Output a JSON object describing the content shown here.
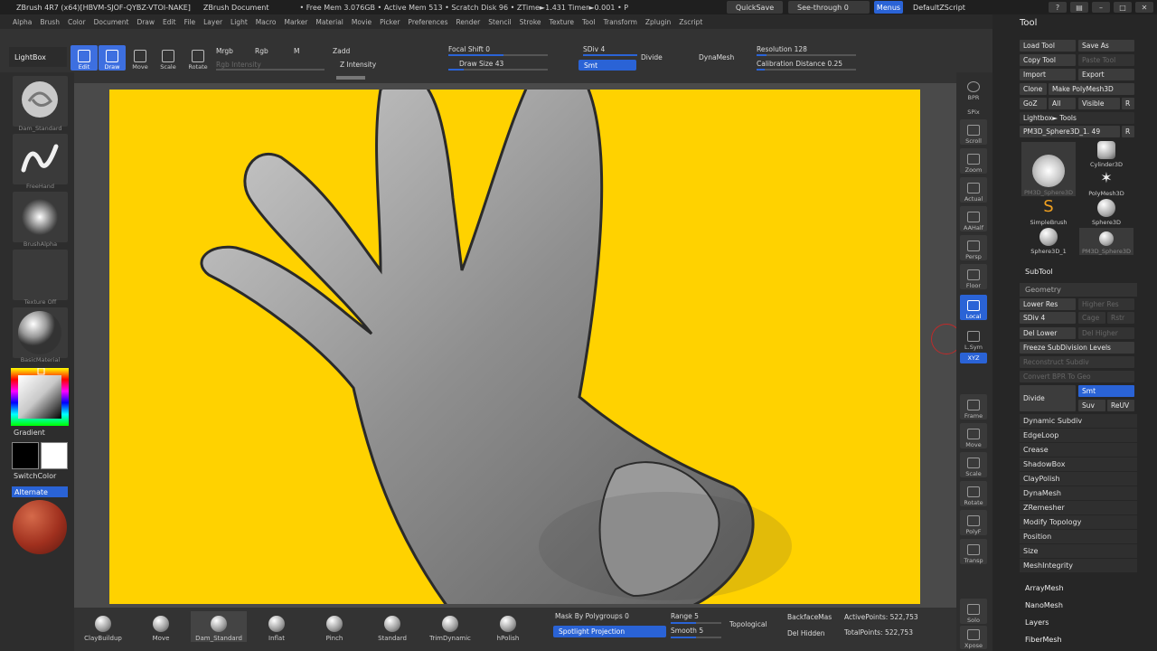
{
  "titlebar": {
    "app": "ZBrush 4R7 (x64)[HBVM-SJOF-QYBZ-VTOI-NAKE]",
    "document": "ZBrush Document",
    "stats": "• Free Mem 3.076GB • Active Mem 513 • Scratch Disk 96 • ZTime►1.431 Timer►0.001 • P",
    "quicksave": "QuickSave",
    "seethrough": "See-through  0",
    "menus": "Menus",
    "script": "DefaultZScript"
  },
  "menubar": [
    "Alpha",
    "Brush",
    "Color",
    "Document",
    "Draw",
    "Edit",
    "File",
    "Layer",
    "Light",
    "Macro",
    "Marker",
    "Material",
    "Movie",
    "Picker",
    "Preferences",
    "Render",
    "Stencil",
    "Stroke",
    "Texture",
    "Tool",
    "Transform",
    "Zplugin",
    "Zscript"
  ],
  "topshelf": {
    "lightbox": "LightBox",
    "edit": "Edit",
    "draw": "Draw",
    "move": "Move",
    "scale": "Scale",
    "rotate": "Rotate",
    "mrgb": "Mrgb",
    "rgb": "Rgb",
    "m": "M",
    "zadd": "Zadd",
    "rgb_intensity": "Rgb Intensity",
    "z_intensity": "Z Intensity",
    "focal_shift": "Focal Shift 0",
    "draw_size": "Draw Size 43",
    "sdiv": "SDiv 4",
    "smt": "Smt",
    "divide": "Divide",
    "dynamesh": "DynaMesh",
    "resolution": "Resolution 128",
    "calibration": "Calibration Distance 0.25"
  },
  "leftpanel": {
    "brush": "Dam_Standard",
    "stroke": "FreeHand",
    "alpha": "BrushAlpha",
    "texture": "Texture Off",
    "material": "BasicMaterial",
    "gradient": "Gradient",
    "switchcolor": "SwitchColor",
    "alternate": "Alternate"
  },
  "rightstrip": [
    "BPR",
    "SPix",
    "Scroll",
    "Zoom",
    "Actual",
    "AAHalf",
    "Persp",
    "Floor",
    "Local",
    "L.Sym",
    "XYZ",
    "Frame",
    "Move",
    "Scale",
    "Rotate",
    "PolyF",
    "Transp",
    "Solo",
    "Xpose"
  ],
  "bottomshelf": {
    "brushes": [
      "ClayBuildup",
      "Move",
      "Dam_Standard",
      "Inflat",
      "Pinch",
      "Standard",
      "TrimDynamic",
      "hPolish"
    ],
    "mask_by_polygroups": "Mask By Polygroups 0",
    "spotlight_projection": "Spotlight Projection",
    "range": "Range 5",
    "smooth": "Smooth 5",
    "topological": "Topological",
    "backfacemask": "BackfaceMas",
    "del_hidden": "Del Hidden",
    "active_points": "ActivePoints: 522,753",
    "total_points": "TotalPoints: 522,753"
  },
  "toolpanel": {
    "title": "Tool",
    "load_tool": "Load Tool",
    "save_as": "Save As",
    "copy_tool": "Copy Tool",
    "paste_tool": "Paste Tool",
    "import": "Import",
    "export": "Export",
    "clone": "Clone",
    "make_polymesh": "Make PolyMesh3D",
    "goz": "GoZ",
    "all": "All",
    "visible": "Visible",
    "r": "R",
    "lightbox_tools": "Lightbox► Tools",
    "current_tool": "PM3D_Sphere3D_1. 49",
    "tools": [
      "PM3D_Sphere3D",
      "Cylinder3D",
      "PolyMesh3D",
      "SimpleBrush",
      "Sphere3D",
      "Sphere3D_1",
      "PM3D_Sphere3D"
    ],
    "subtool": "SubTool",
    "geometry": "Geometry",
    "lower_res": "Lower Res",
    "higher_res": "Higher Res",
    "sdiv": "SDiv 4",
    "cage": "Cage",
    "rstr": "Rstr",
    "del_lower": "Del Lower",
    "del_higher": "Del Higher",
    "freeze": "Freeze SubDivision Levels",
    "reconstruct": "Reconstruct Subdiv",
    "convert_bpr": "Convert BPR To Geo",
    "divide": "Divide",
    "smt": "Smt",
    "suv": "Suv",
    "reuv": "ReUV",
    "sections": [
      "Dynamic Subdiv",
      "EdgeLoop",
      "Crease",
      "ShadowBox",
      "ClayPolish",
      "DynaMesh",
      "ZRemesher",
      "Modify Topology",
      "Position",
      "Size",
      "MeshIntegrity"
    ],
    "bottom_sections": [
      "ArrayMesh",
      "NanoMesh",
      "Layers",
      "FiberMesh"
    ]
  },
  "colors": {
    "accent": "#2a63d6",
    "canvas_bg": "#ffd200"
  }
}
